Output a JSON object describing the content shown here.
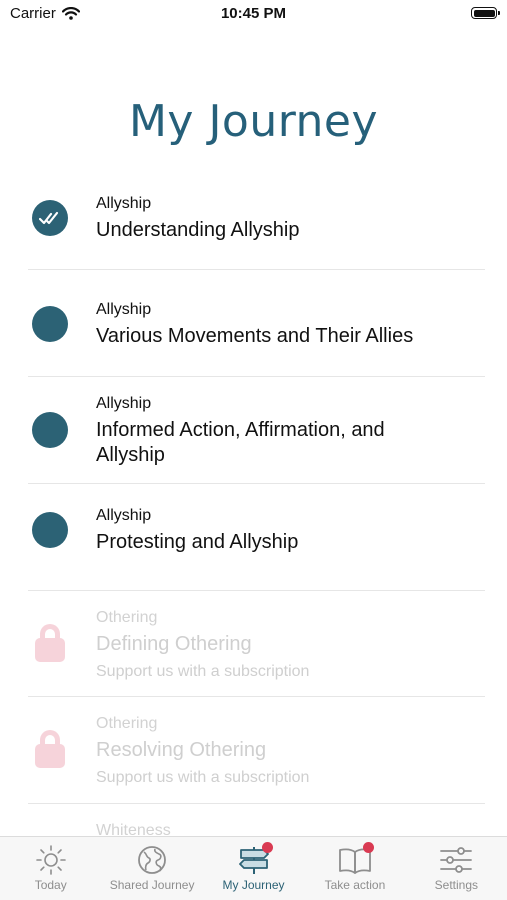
{
  "status_bar": {
    "carrier": "Carrier",
    "time": "10:45 PM"
  },
  "page": {
    "title": "My Journey"
  },
  "journey_items": [
    {
      "category": "Allyship",
      "title": "Understanding Allyship",
      "state": "completed"
    },
    {
      "category": "Allyship",
      "title": "Various Movements and Their Allies",
      "state": "available"
    },
    {
      "category": "Allyship",
      "title": "Informed Action, Affirmation, and Allyship",
      "state": "available"
    },
    {
      "category": "Allyship",
      "title": "Protesting and Allyship",
      "state": "available"
    },
    {
      "category": "Othering",
      "title": "Defining Othering",
      "subtitle": "Support us with a subscription",
      "state": "locked"
    },
    {
      "category": "Othering",
      "title": "Resolving Othering",
      "subtitle": "Support us with a subscription",
      "state": "locked"
    },
    {
      "category": "Whiteness",
      "title": "",
      "subtitle": "",
      "state": "locked"
    }
  ],
  "colors": {
    "accent": "#2c6275",
    "title": "#26607a",
    "lock": "#f6d3da",
    "badge": "#d93a52"
  },
  "tab_bar": {
    "tabs": [
      {
        "label": "Today",
        "icon": "sun-icon",
        "active": false
      },
      {
        "label": "Shared Journey",
        "icon": "globe-icon",
        "active": false
      },
      {
        "label": "My Journey",
        "icon": "signpost-icon",
        "active": true,
        "badge": true
      },
      {
        "label": "Take action",
        "icon": "book-icon",
        "active": false,
        "badge": true
      },
      {
        "label": "Settings",
        "icon": "sliders-icon",
        "active": false
      }
    ]
  }
}
